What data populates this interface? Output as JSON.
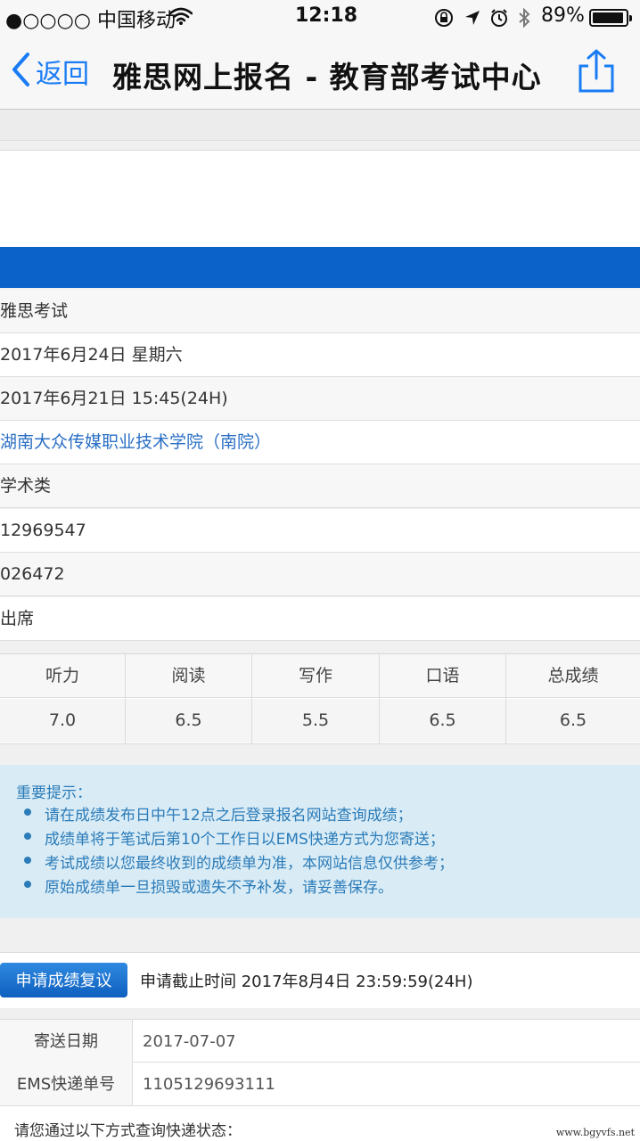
{
  "status_bar": {
    "carrier": "●○○○○ 中国移动",
    "time": "12:18",
    "battery": "89%"
  },
  "nav": {
    "back_label": "返回",
    "title": "雅思网上报名 - 教育部考试中心"
  },
  "exam_info": {
    "rows": [
      "雅思考试",
      "2017年6月24日 星期六",
      "2017年6月21日 15:45(24H)",
      "湖南大众传媒职业技术学院（南院）",
      "学术类",
      "12969547",
      "026472",
      "出席"
    ]
  },
  "scores": {
    "headers": [
      "听力",
      "阅读",
      "写作",
      "口语",
      "总成绩"
    ],
    "values": [
      "7.0",
      "6.5",
      "5.5",
      "6.5",
      "6.5"
    ]
  },
  "notice": {
    "title": "重要提示：",
    "items": [
      "请在成绩发布日中午12点之后登录报名网站查询成绩；",
      "成绩单将于笔试后第10个工作日以EMS快递方式为您寄送；",
      "考试成绩以您最终收到的成绩单为准，本网站信息仅供参考；",
      "原始成绩单一旦损毁或遗失不予补发，请妥善保存。"
    ]
  },
  "review": {
    "button_label": "申请成绩复议",
    "deadline_text": "申请截止时间 2017年8月4日 23:59:59(24H)"
  },
  "shipping": {
    "rows": [
      {
        "label": "寄送日期",
        "value": "2017-07-07"
      },
      {
        "label": "EMS快递单号",
        "value": "1105129693111"
      }
    ],
    "hint": "请您通过以下方式查询快递状态："
  },
  "watermark": "www.bgyvfs.net",
  "colors": {
    "accent_blue": "#1a7cf4",
    "header_bar": "#0b63c9",
    "notice_bg": "#d9ecf6",
    "notice_text": "#2b7bb8",
    "link_text": "#2a6fc4"
  }
}
